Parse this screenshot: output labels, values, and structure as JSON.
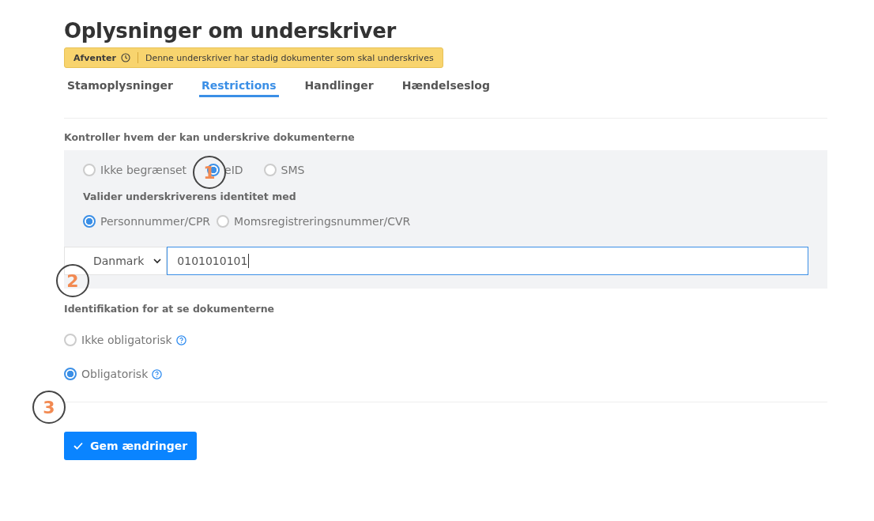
{
  "title": "Oplysninger om underskriver",
  "status": {
    "label": "Afventer",
    "message": "Denne underskriver har stadig dokumenter som skal underskrives"
  },
  "tabs": [
    {
      "label": "Stamoplysninger",
      "selected": false
    },
    {
      "label": "Restrictions",
      "selected": true
    },
    {
      "label": "Handlinger",
      "selected": false
    },
    {
      "label": "Hændelseslog",
      "selected": false
    }
  ],
  "signing_control": {
    "heading": "Kontroller hvem der kan underskrive dokumenterne",
    "options": [
      {
        "label": "Ikke begrænset",
        "selected": false
      },
      {
        "label": "eID",
        "selected": true
      },
      {
        "label": "SMS",
        "selected": false
      }
    ],
    "validate_heading": "Valider underskriverens identitet med",
    "validate_options": [
      {
        "label": "Personnummer/CPR",
        "selected": true
      },
      {
        "label": "Momsregistreringsnummer/CVR",
        "selected": false
      }
    ],
    "country": "Danmark",
    "id_value": "0101010101"
  },
  "view_identification": {
    "heading": "Identifikation for at se dokumenterne",
    "options": [
      {
        "label": "Ikke obligatorisk",
        "selected": false
      },
      {
        "label": "Obligatorisk",
        "selected": true
      }
    ]
  },
  "save_button": "Gem ændringer",
  "callouts": [
    "1",
    "2",
    "3"
  ]
}
